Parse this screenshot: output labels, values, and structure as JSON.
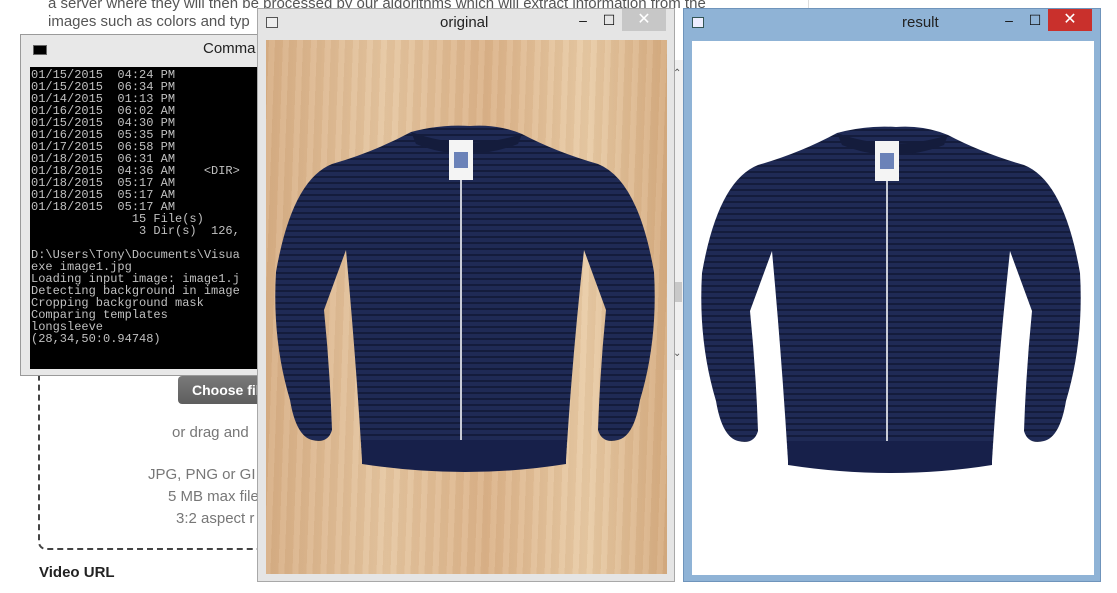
{
  "background_page": {
    "intro_lines": [
      "a server where they will then be processed by our algorithms which will extract information from the",
      "images such as colors and typ"
    ],
    "choose_button": "Choose file",
    "drag_text": "or drag and",
    "formats": "JPG, PNG or GI",
    "max_size": "5 MB max file",
    "aspect": "3:2 aspect r",
    "video_url_label": "Video URL"
  },
  "cmd_window": {
    "title": "Comma",
    "lines": [
      "01/15/2015  04:24 PM",
      "01/15/2015  06:34 PM",
      "01/14/2015  01:13 PM",
      "01/16/2015  06:02 AM",
      "01/15/2015  04:30 PM",
      "01/16/2015  05:35 PM",
      "01/17/2015  06:58 PM",
      "01/18/2015  06:31 AM",
      "01/18/2015  04:36 AM    <DIR>",
      "01/18/2015  05:17 AM",
      "01/18/2015  05:17 AM",
      "01/18/2015  05:17 AM",
      "              15 File(s)",
      "               3 Dir(s)  126,",
      "",
      "D:\\Users\\Tony\\Documents\\Visua",
      "exe image1.jpg",
      "Loading input image: image1.j",
      "Detecting background in image",
      "Cropping background mask",
      "Comparing templates",
      "longsleeve",
      "(28,34,50:0.94748)"
    ]
  },
  "original_window": {
    "title": "original",
    "minimize": "‒",
    "maximize": "☐",
    "close": "✕"
  },
  "result_window": {
    "title": "result",
    "minimize": "‒",
    "maximize": "☐",
    "close": "✕"
  },
  "colors": {
    "jacket": "#1f2a55",
    "wood": "#e0bb92",
    "result_frame": "#8fb3d6",
    "close_red": "#c9302c"
  }
}
